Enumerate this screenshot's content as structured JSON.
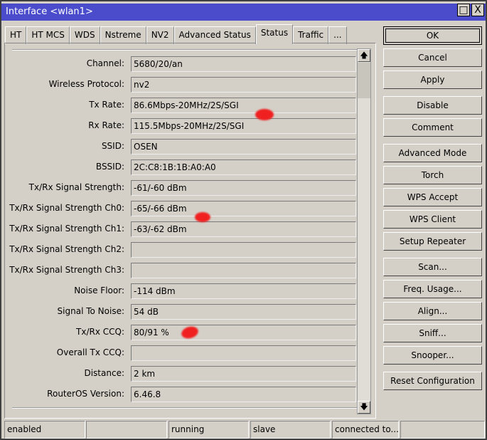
{
  "window": {
    "title": "Interface <wlan1>",
    "maximize_icon": "□",
    "close_icon": "X"
  },
  "tabs": [
    "HT",
    "HT MCS",
    "WDS",
    "Nstreme",
    "NV2",
    "Advanced Status",
    "Status",
    "Traffic",
    "..."
  ],
  "active_tab": "Status",
  "fields": [
    {
      "label": "Channel:",
      "value": "5680/20/an"
    },
    {
      "label": "Wireless Protocol:",
      "value": "nv2"
    },
    {
      "label": "Tx Rate:",
      "value": "86.6Mbps-20MHz/2S/SGI"
    },
    {
      "label": "Rx Rate:",
      "value": "115.5Mbps-20MHz/2S/SGI"
    },
    {
      "label": "SSID:",
      "value": "OSEN"
    },
    {
      "label": "BSSID:",
      "value": "2C:C8:1B:1B:A0:A0"
    },
    {
      "label": "Tx/Rx Signal Strength:",
      "value": "-61/-60 dBm"
    },
    {
      "label": "Tx/Rx Signal Strength Ch0:",
      "value": "-65/-66 dBm"
    },
    {
      "label": "Tx/Rx Signal Strength Ch1:",
      "value": "-63/-62 dBm"
    },
    {
      "label": "Tx/Rx Signal Strength Ch2:",
      "value": ""
    },
    {
      "label": "Tx/Rx Signal Strength Ch3:",
      "value": ""
    },
    {
      "label": "Noise Floor:",
      "value": "-114 dBm"
    },
    {
      "label": "Signal To Noise:",
      "value": "54 dB"
    },
    {
      "label": "Tx/Rx CCQ:",
      "value": "80/91 %"
    },
    {
      "label": "Overall Tx CCQ:",
      "value": ""
    },
    {
      "label": "Distance:",
      "value": "2 km"
    },
    {
      "label": "RouterOS Version:",
      "value": "6.46.8"
    }
  ],
  "buttons": [
    "OK",
    "Cancel",
    "Apply",
    "Disable",
    "Comment",
    "Advanced Mode",
    "Torch",
    "WPS Accept",
    "WPS Client",
    "Setup Repeater",
    "Scan...",
    "Freq. Usage...",
    "Align...",
    "Sniff...",
    "Snooper...",
    "Reset Configuration"
  ],
  "scroll": {
    "up_icon": "🡅",
    "down_icon": "🡇"
  },
  "statusbar": [
    "enabled",
    "",
    "running",
    "slave",
    "connected to...",
    ""
  ]
}
